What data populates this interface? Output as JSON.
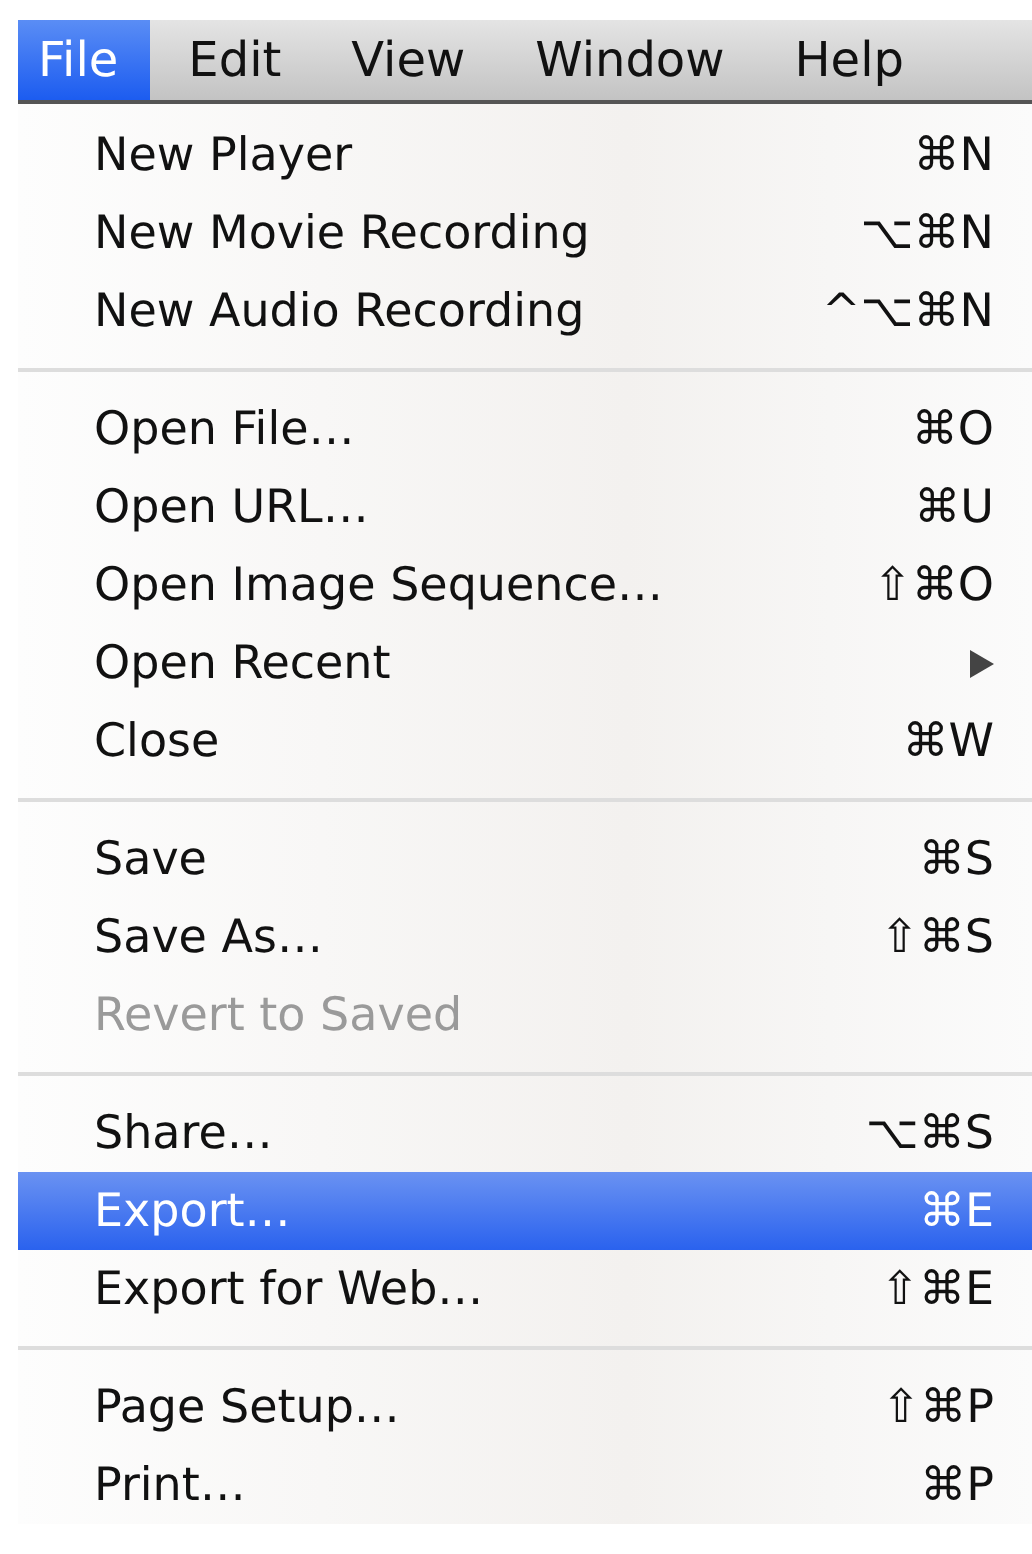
{
  "menu_bar": [
    {
      "label": "File",
      "selected": true
    },
    {
      "label": "Edit",
      "selected": false
    },
    {
      "label": "View",
      "selected": false
    },
    {
      "label": "Window",
      "selected": false
    },
    {
      "label": "Help",
      "selected": false
    }
  ],
  "menu": {
    "groups": [
      {
        "items": [
          {
            "kind": "action",
            "label": "New Player",
            "shortcut": "⌘N",
            "selected": false,
            "disabled": false
          },
          {
            "kind": "action",
            "label": "New Movie Recording",
            "shortcut": "⌥⌘N",
            "selected": false,
            "disabled": false
          },
          {
            "kind": "action",
            "label": "New Audio Recording",
            "shortcut": "^⌥⌘N",
            "selected": false,
            "disabled": false
          }
        ]
      },
      {
        "items": [
          {
            "kind": "action",
            "label": "Open File…",
            "shortcut": "⌘O",
            "selected": false,
            "disabled": false
          },
          {
            "kind": "action",
            "label": "Open URL…",
            "shortcut": "⌘U",
            "selected": false,
            "disabled": false
          },
          {
            "kind": "action",
            "label": "Open Image Sequence…",
            "shortcut": "⇧⌘O",
            "selected": false,
            "disabled": false
          },
          {
            "kind": "submenu",
            "label": "Open Recent",
            "selected": false,
            "disabled": false
          },
          {
            "kind": "action",
            "label": "Close",
            "shortcut": "⌘W",
            "selected": false,
            "disabled": false
          }
        ]
      },
      {
        "items": [
          {
            "kind": "action",
            "label": "Save",
            "shortcut": "⌘S",
            "selected": false,
            "disabled": false
          },
          {
            "kind": "action",
            "label": "Save As…",
            "shortcut": "⇧⌘S",
            "selected": false,
            "disabled": false
          },
          {
            "kind": "action",
            "label": "Revert to Saved",
            "selected": false,
            "disabled": true
          }
        ]
      },
      {
        "items": [
          {
            "kind": "action",
            "label": "Share…",
            "shortcut": "⌥⌘S",
            "selected": false,
            "disabled": false
          },
          {
            "kind": "action",
            "label": "Export…",
            "shortcut": "⌘E",
            "selected": true,
            "disabled": false
          },
          {
            "kind": "action",
            "label": "Export for Web…",
            "shortcut": "⇧⌘E",
            "selected": false,
            "disabled": false
          }
        ]
      },
      {
        "items": [
          {
            "kind": "action",
            "label": "Page Setup…",
            "shortcut": "⇧⌘P",
            "selected": false,
            "disabled": false
          },
          {
            "kind": "action",
            "label": "Print…",
            "shortcut": "⌘P",
            "selected": false,
            "disabled": false
          }
        ]
      }
    ]
  }
}
